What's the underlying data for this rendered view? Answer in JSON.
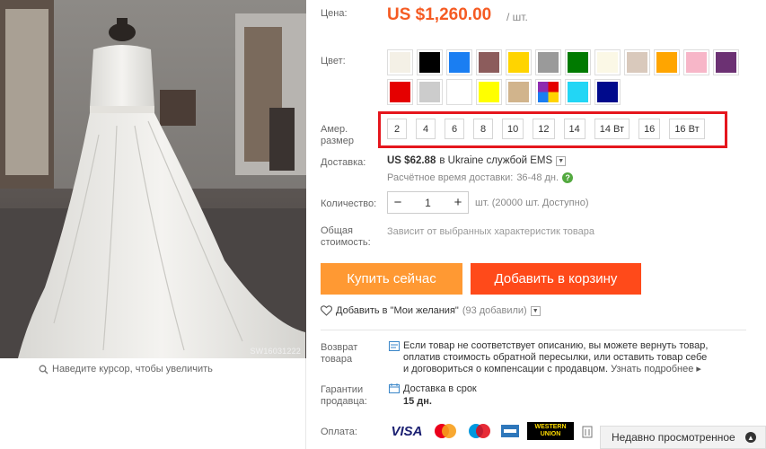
{
  "photo": {
    "sku_stamp": "SW16031222"
  },
  "zoom_hint": "Наведите курсор, чтобы увеличить",
  "price": {
    "label": "Цена:",
    "value": "US $1,260.00",
    "per_unit": "/ шт."
  },
  "color": {
    "label": "Цвет:",
    "swatches": [
      "#f4f0e6",
      "#000000",
      "#1a7ef2",
      "#8c5c5c",
      "#ffd400",
      "#9a9a9a",
      "#007a00",
      "#fbf8e6",
      "#d9c9bc",
      "#ffa500",
      "#f7b6c8",
      "#6c3173",
      "#e50000",
      "#cccccc",
      "#ffffff",
      "#ffff00",
      "#d1b48c",
      "multicolor",
      "#22d6f5",
      "#000a8c"
    ]
  },
  "size": {
    "label_line1": "Амер.",
    "label_line2": "размер",
    "options": [
      "2",
      "4",
      "6",
      "8",
      "10",
      "12",
      "14",
      "14 Вт",
      "16",
      "16 Вт"
    ]
  },
  "shipping": {
    "label": "Доставка:",
    "cost": "US $62.88",
    "to": "в Ukraine службой EMS",
    "time_label": "Расчётное время доставки:",
    "time_value": "36-48 дн."
  },
  "quantity": {
    "label": "Количество:",
    "value": "1",
    "note": "шт. (20000 шт. Доступно)"
  },
  "total": {
    "label_line1": "Общая",
    "label_line2": "стоимость:",
    "value": "Зависит от выбранных характеристик товара"
  },
  "buttons": {
    "buy_now": "Купить сейчас",
    "add_to_cart": "Добавить в корзину"
  },
  "wishlist": {
    "label": "Добавить в \"Мои желания\"",
    "count": "(93 добавили)"
  },
  "returns": {
    "label_line1": "Возврат",
    "label_line2": "товара",
    "text": "Если товар не соответствует описанию, вы можете вернуть товар, оплатив стоимость обратной пересылки, или оставить товар себе и договориться о компенсации с продавцом.",
    "more": "Узнать подробнее ▸"
  },
  "guarantee": {
    "label_line1": "Гарантии",
    "label_line2": "продавца:",
    "title": "Доставка в срок",
    "days": "15 дн."
  },
  "payment": {
    "label": "Оплата:",
    "visa": "VISA",
    "wu": "WESTERN UNION"
  },
  "recently_viewed": "Недавно просмотренное"
}
